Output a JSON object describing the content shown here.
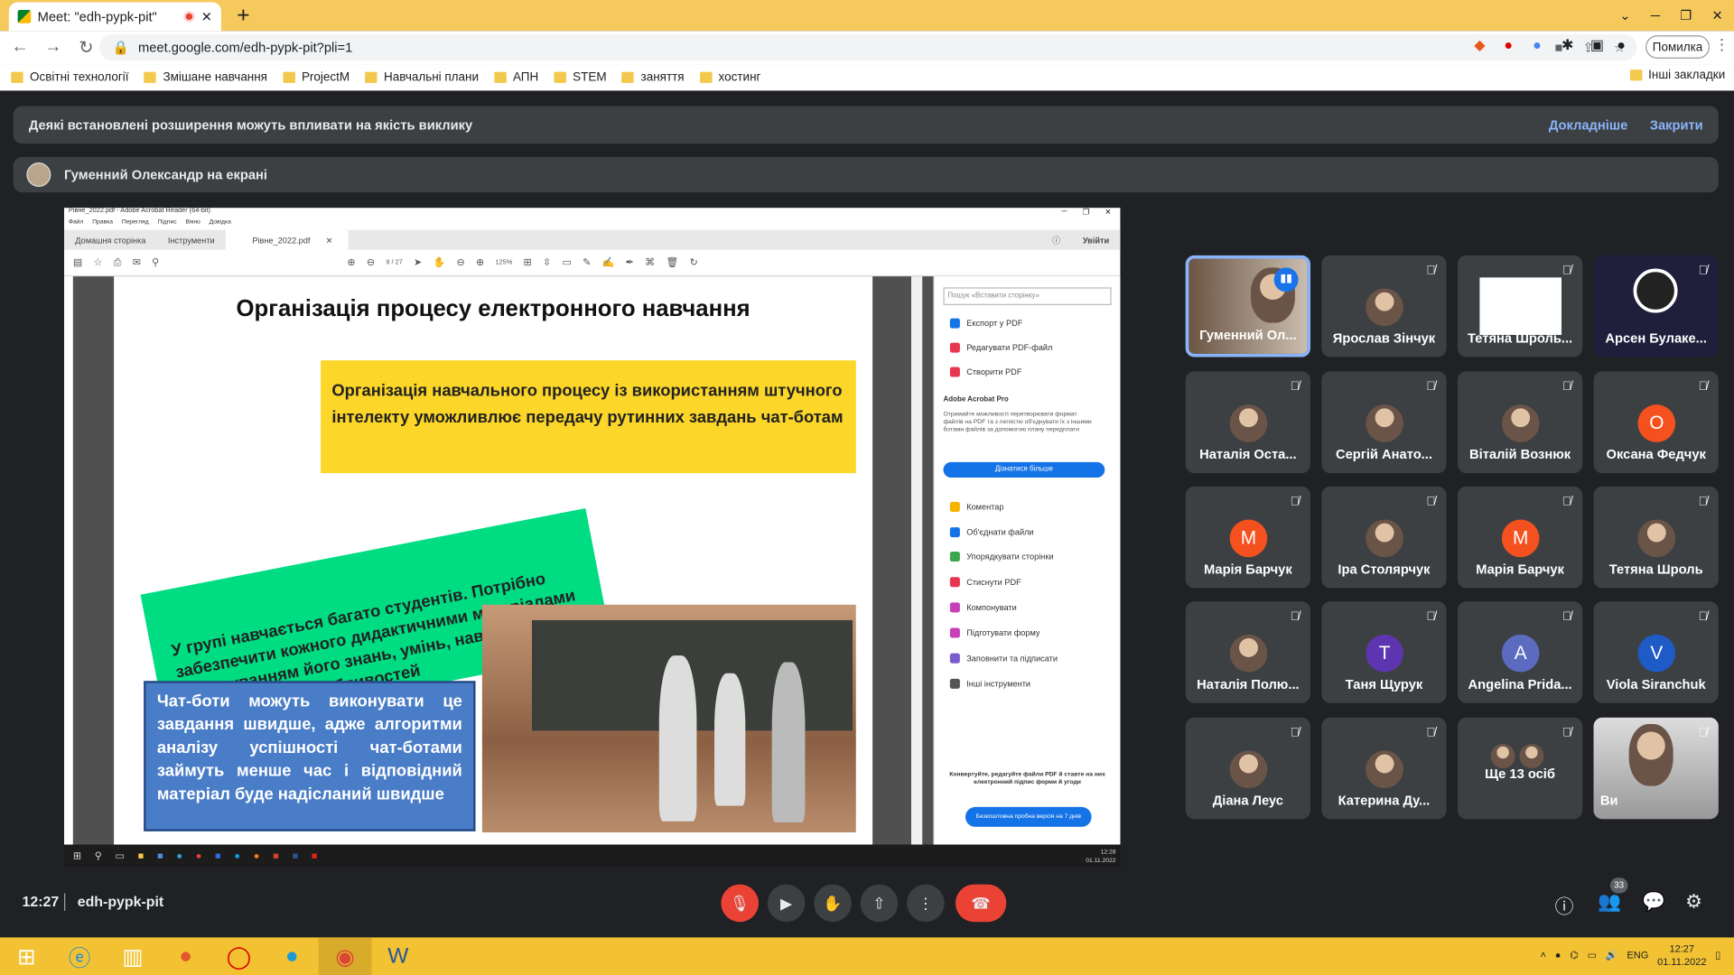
{
  "browser": {
    "tab_title": "Meet: \"edh-pypk-pit\"",
    "url": "meet.google.com/edh-pypk-pit?pli=1",
    "error_label": "Помилка",
    "bookmarks": [
      "Освітні технології",
      "Змішане навчання",
      "ProjectM",
      "Навчальні плани",
      "АПН",
      "STEM",
      "заняття",
      "хостинг"
    ],
    "other_bookmarks": "Інші закладки"
  },
  "banner": {
    "text": "Деякі встановлені розширення можуть впливати на якість виклику",
    "more": "Докладніше",
    "close": "Закрити"
  },
  "presenter": {
    "text": "Гуменний Олександр на екрані"
  },
  "acrobat": {
    "title": "Рівне_2022.pdf - Adobe Acrobat Reader (64-bit)",
    "menu": [
      "Файл",
      "Правка",
      "Перегляд",
      "Підпис",
      "Вікно",
      "Довідка"
    ],
    "tabs": [
      "Домашня сторінка",
      "Інструменти",
      "Рівне_2022.pdf"
    ],
    "signin": "Увійти",
    "page": "9 / 27",
    "zoom": "125%",
    "search_placeholder": "Пошук «Вставити сторінку»",
    "tools": [
      "Експорт у PDF",
      "Редагувати PDF-файл",
      "Створити PDF"
    ],
    "pro_title": "Adobe Acrobat Pro",
    "pro_desc": "Отримайте можливості перетворювати формат файлів на PDF та з легкістю об'єднувати їх з іншими ботами файлів за допомогою плану передплати",
    "learn_more": "Дізнатися більше",
    "tools2": [
      "Коментар",
      "Об'єднати файли",
      "Упорядкувати сторінки",
      "Стиснути PDF",
      "Компонувати",
      "Підготувати форму",
      "Заповнити та підписати",
      "Інші інструменти"
    ],
    "promo": "Конвертуйте, редагуйте файли PDF й ставте на них електронний підпис форми й угоди",
    "trial": "Безкоштовна пробна версія на 7 днів",
    "clock_time": "12:28",
    "clock_date": "01.11.2022"
  },
  "slide": {
    "title": "Організація процесу електронного навчання",
    "yellow": "Організація навчального процесу із використанням штучного інтелекту уможливлює передачу рутинних завдань чат-ботам",
    "green": "У групі навчається багато студентів. Потрібно забезпечити кожного дидактичними матеріалами з урахуванням його знань, умінь, навичок, психологічних особливостей",
    "blue": "Чат-боти можуть виконувати це завдання швидше, адже алгоритми аналізу успішності чат-ботами займуть менше час і відповідний матеріал буде надісланий швидше"
  },
  "participants": [
    {
      "name": "Гуменний Ол...",
      "type": "photo",
      "active": true
    },
    {
      "name": "Ярослав Зінчук",
      "type": "photo"
    },
    {
      "name": "Тетяна Шроль...",
      "type": "screen"
    },
    {
      "name": "Арсен Булаке...",
      "type": "logo"
    },
    {
      "name": "Наталія Оста...",
      "type": "photo"
    },
    {
      "name": "Сергій Анато...",
      "type": "photo"
    },
    {
      "name": "Віталій Вознюк",
      "type": "photo"
    },
    {
      "name": "Оксана Федчук",
      "type": "letter",
      "letter": "О",
      "color": "#f4511e"
    },
    {
      "name": "Марія Барчук",
      "type": "letter",
      "letter": "М",
      "color": "#f4511e"
    },
    {
      "name": "Іра Столярчук",
      "type": "photo"
    },
    {
      "name": "Марія Барчук",
      "type": "letter",
      "letter": "М",
      "color": "#f4511e"
    },
    {
      "name": "Тетяна Шроль",
      "type": "photo"
    },
    {
      "name": "Наталія Полю...",
      "type": "photo"
    },
    {
      "name": "Таня Щурук",
      "type": "letter",
      "letter": "T",
      "color": "#5e35b1"
    },
    {
      "name": "Angelina Prida...",
      "type": "letter",
      "letter": "A",
      "color": "#5c6bc0"
    },
    {
      "name": "Viola Siranchuk",
      "type": "letter",
      "letter": "V",
      "color": "#1e5bc6"
    },
    {
      "name": "Діана Леус",
      "type": "photo"
    },
    {
      "name": "Катерина Ду...",
      "type": "photo"
    },
    {
      "name": "Ще 13 осіб",
      "type": "more"
    },
    {
      "name": "Ви",
      "type": "video"
    }
  ],
  "bottom": {
    "time": "12:27",
    "code": "edh-pypk-pit",
    "people_count": "33"
  },
  "taskbar": {
    "lang": "ENG",
    "time": "12:27",
    "date": "01.11.2022"
  }
}
